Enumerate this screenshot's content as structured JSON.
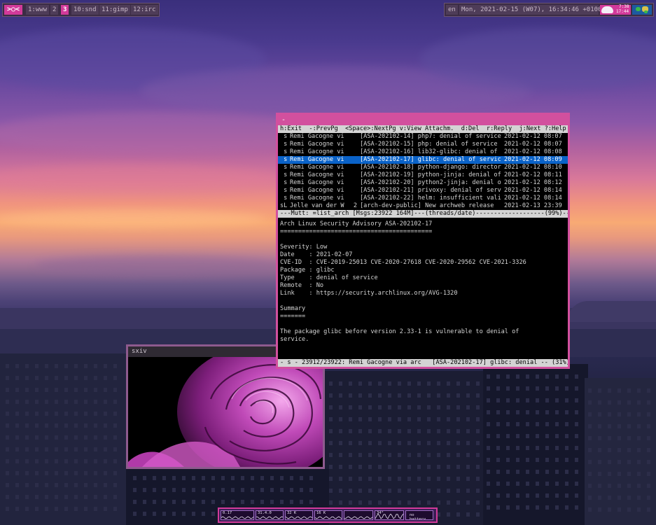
{
  "topbar": {
    "logo": ">○<",
    "workspaces": [
      {
        "label": "1:www",
        "active": false
      },
      {
        "label": "2",
        "active": false
      },
      {
        "label": "3",
        "active": true
      },
      {
        "label": "10:snd",
        "active": false
      },
      {
        "label": "11:gimp",
        "active": false
      },
      {
        "label": "12:irc",
        "active": false
      }
    ],
    "keyboard_layout": "en",
    "datetime": "Mon, 2021-02-15 (W07), 16:34:46 +0100",
    "sun_times": {
      "rise": "7:38",
      "set": "17:44"
    },
    "icons": [
      "weather-icon",
      "world-map-icon"
    ]
  },
  "mutt": {
    "window_title": "-",
    "help_bar": "h:Exit  -:PrevPg  <Space>:NextPg v:View Attachm.  d:Del  r:Reply  j:Next ?:Help",
    "index": [
      {
        "flag": " s",
        "from": "Remi Gacogne vi",
        "count": "",
        "subject": "[ASA-202102-14] php7: denial of service",
        "date": "2021-02-12 08:07",
        "selected": false
      },
      {
        "flag": " s",
        "from": "Remi Gacogne vi",
        "count": "",
        "subject": "[ASA-202102-15] php: denial of service",
        "date": "2021-02-12 08:07",
        "selected": false
      },
      {
        "flag": " s",
        "from": "Remi Gacogne vi",
        "count": "",
        "subject": "[ASA-202102-16] lib32-glibc: denial of",
        "date": "2021-02-12 08:08",
        "selected": false
      },
      {
        "flag": " s",
        "from": "Remi Gacogne vi",
        "count": "",
        "subject": "[ASA-202102-17] glibc: denial of servic",
        "date": "2021-02-12 08:09",
        "selected": true
      },
      {
        "flag": " s",
        "from": "Remi Gacogne vi",
        "count": "",
        "subject": "[ASA-202102-18] python-django: director",
        "date": "2021-02-12 08:10",
        "selected": false
      },
      {
        "flag": " s",
        "from": "Remi Gacogne vi",
        "count": "",
        "subject": "[ASA-202102-19] python-jinja: denial of",
        "date": "2021-02-12 08:11",
        "selected": false
      },
      {
        "flag": " s",
        "from": "Remi Gacogne vi",
        "count": "",
        "subject": "[ASA-202102-20] python2-jinja: denial o",
        "date": "2021-02-12 08:12",
        "selected": false
      },
      {
        "flag": " s",
        "from": "Remi Gacogne vi",
        "count": "",
        "subject": "[ASA-202102-21] privoxy: denial of serv",
        "date": "2021-02-12 08:14",
        "selected": false
      },
      {
        "flag": " s",
        "from": "Remi Gacogne vi",
        "count": "",
        "subject": "[ASA-202102-22] helm: insufficient vali",
        "date": "2021-02-12 08:14",
        "selected": false
      },
      {
        "flag": "sL",
        "from": "Jelle van der W",
        "count": "2",
        "subject": "[arch-dev-public] New archweb release",
        "date": "2021-02-13 23:39",
        "selected": false
      }
    ],
    "index_status": "---Mutt: =list_arch [Msgs:23922 164M]---(threads/date)-------------------(99%)---",
    "body_lines": [
      "Arch Linux Security Advisory ASA-202102-17",
      "==========================================",
      "",
      "Severity: Low",
      "Date    : 2021-02-07",
      "CVE-ID  : CVE-2019-25013 CVE-2020-27618 CVE-2020-29562 CVE-2021-3326",
      "Package : glibc",
      "Type    : denial of service",
      "Remote  : No",
      "Link    : https://security.archlinux.org/AVG-1320",
      "",
      "Summary",
      "=======",
      "",
      "The package glibc before version 2.33-1 is vulnerable to denial of",
      "service."
    ],
    "pager_status": "- s - 23912/23922: Remi Gacogne via arc   [ASA-202102-17] glibc: denial -- (31%)"
  },
  "sxiv": {
    "window_title": "sxiv"
  },
  "widgets": [
    {
      "name": "cpu-widget",
      "label": "0.17",
      "width": 48,
      "color": "#e8e0f0"
    },
    {
      "name": "memory-widget",
      "label": "31.4.0",
      "width": 40,
      "color": "#e8e0f0"
    },
    {
      "name": "net-down-widget",
      "label": "32 K",
      "width": 40,
      "color": "#e8e0f0"
    },
    {
      "name": "net-up-widget",
      "label": "16 K",
      "width": 40,
      "color": "#e8e0f0"
    },
    {
      "name": "disk-widget",
      "label": "",
      "width": 42,
      "color": "#e8e0f0"
    },
    {
      "name": "temp-widget",
      "label": "34°",
      "width": 42,
      "color": "#e8e0f0"
    },
    {
      "name": "battery-widget",
      "label": "no battery",
      "width": 40,
      "color": "#e8e0f0"
    }
  ]
}
